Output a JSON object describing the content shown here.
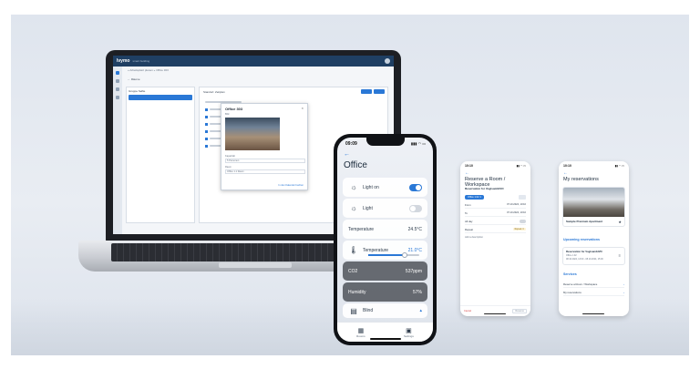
{
  "laptop": {
    "app_logo": "Ivymo",
    "app_logo_sub": "smart building",
    "breadcrumb": "« Arbeitsplatz planen » Office 303",
    "toolbar_label": "← Räume",
    "left_panel_title": "Gruppe Selfie",
    "right_panel_title": "Standort: Zeitplan",
    "modal": {
      "title": "Office 303",
      "image_label": "Bild",
      "field1_label": "Kapazität",
      "field1_value": "5 Personen",
      "field2_label": "Raum",
      "field2_value": "Office 1.1 Raum",
      "link": "In den Kalender buchen"
    }
  },
  "phone": {
    "time": "09:09",
    "status_right": "▮▮▮ ◠ ▭",
    "back": "←",
    "title": "Office",
    "tiles": [
      {
        "label": "Light on",
        "icon": "light-icon",
        "glyph": "☼",
        "type": "toggle",
        "on": true
      },
      {
        "label": "Light",
        "icon": "light-icon",
        "glyph": "☼",
        "type": "toggle",
        "on": false
      },
      {
        "label": "Temperature",
        "icon": "",
        "glyph": "",
        "type": "value",
        "value": "24.5°C"
      },
      {
        "label": "Temperature",
        "icon": "thermometer-icon",
        "glyph": "🌡",
        "type": "slider",
        "value": "21.0°C",
        "level": 0.7
      },
      {
        "label": "CO2",
        "icon": "",
        "glyph": "",
        "type": "value",
        "value": "537ppm"
      },
      {
        "label": "Humidity",
        "icon": "",
        "glyph": "",
        "type": "value",
        "value": "57%"
      },
      {
        "label": "Blind",
        "icon": "blind-icon",
        "glyph": "▤",
        "type": "value",
        "value": "▴"
      }
    ],
    "tabs": [
      {
        "label": "Rooms",
        "icon": "rooms-icon",
        "glyph": "▦"
      },
      {
        "label": "Settings",
        "icon": "settings-icon",
        "glyph": "▣"
      }
    ]
  },
  "screen_reserve": {
    "time": "10:10",
    "status_right": "▮▮ ◠ ▭",
    "back": "←",
    "title": "Reserve a Room / Workspace",
    "subtitle": "Reservation for Vogtsam/HVO",
    "chip": "Office 1.02 ✕",
    "rows": [
      {
        "label": "From",
        "value": "07.10.2024, 10:10"
      },
      {
        "label": "To",
        "value": "07.10.2024, 10:10"
      },
      {
        "label": "All day",
        "value": ""
      },
      {
        "label": "Repeat",
        "value": "Repeat ✕"
      }
    ],
    "add_description": "Add a description",
    "cancel": "Cancel",
    "reserve": "Reserve"
  },
  "screen_reservations": {
    "time": "10:10",
    "status_right": "▮▮ ◠ ▭",
    "back": "←",
    "title": "My reservations",
    "room_name": "Sample Premium Apartment",
    "room_star": "★",
    "upcoming_title": "Upcoming reservations",
    "reservation_title": "Reservation for Vogtsam/HVO",
    "reservation_meta1": "Office 1.02",
    "reservation_meta2": "08.10.2024, 13:00 - 08.10.2024, 15:00",
    "reservation_icon": "≡",
    "services_title": "Services",
    "services": [
      {
        "label": "Reserve a Room / Workspace",
        "arrow": "›"
      },
      {
        "label": "My reservations",
        "arrow": "›"
      }
    ]
  }
}
